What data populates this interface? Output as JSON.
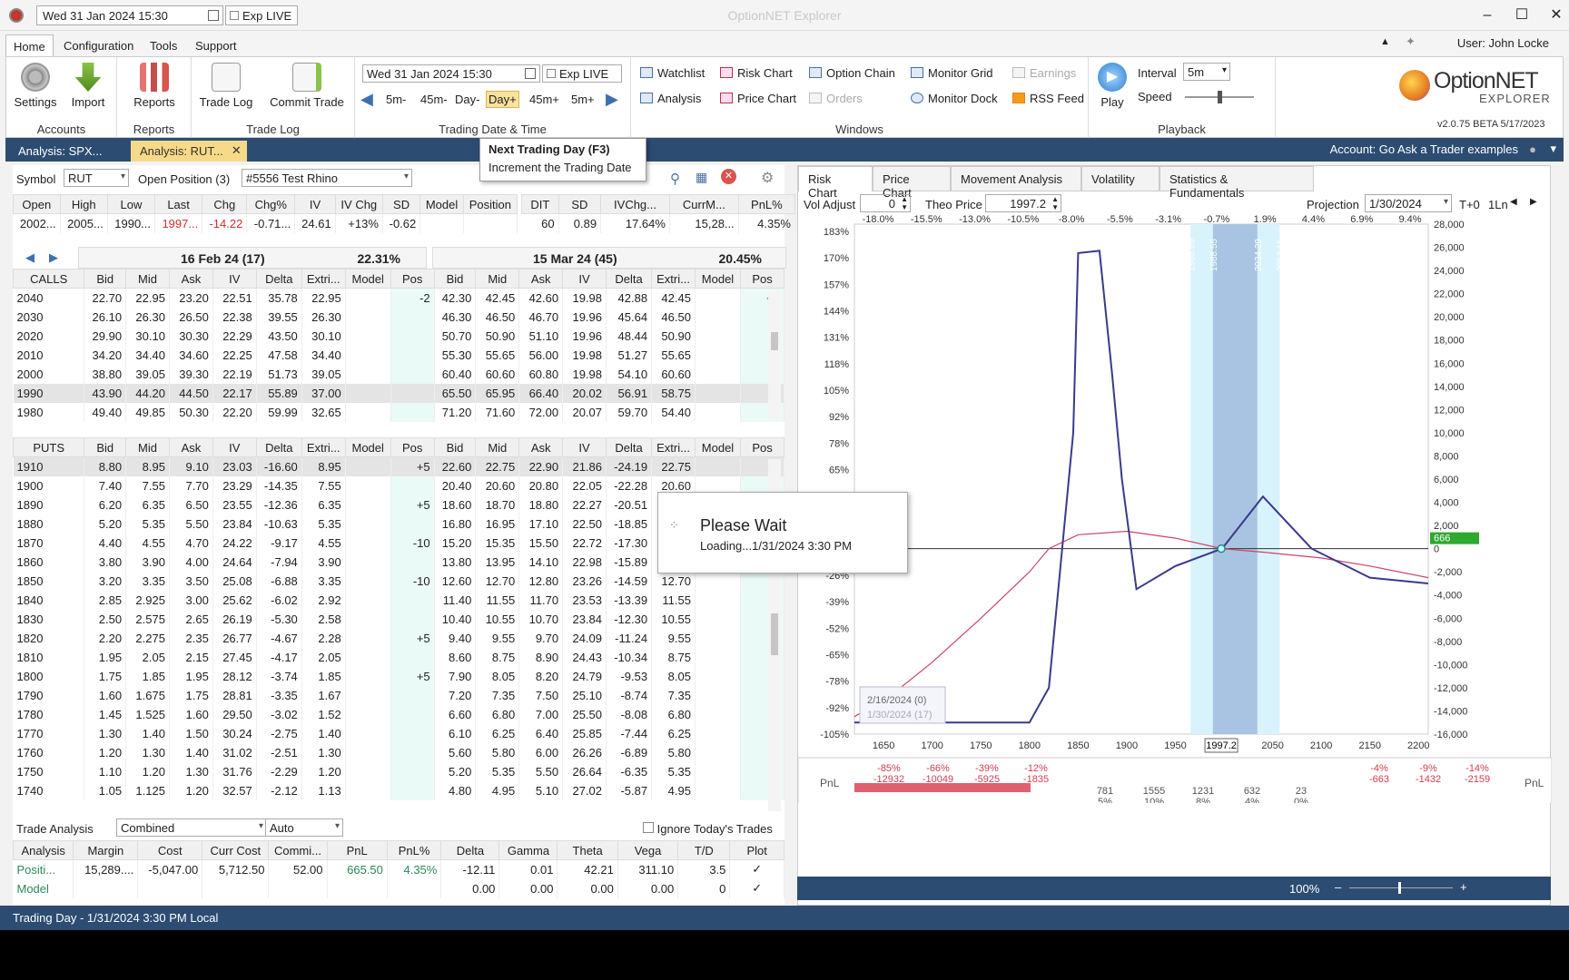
{
  "window": {
    "title": "OptionNET Explorer",
    "date": "Wed 31 Jan 2024 15:30",
    "exp": "Exp LIVE"
  },
  "menu": {
    "tabs": [
      "Home",
      "Configuration",
      "Tools",
      "Support"
    ],
    "user": "User: John Locke"
  },
  "ribbon": {
    "settings": "Settings",
    "import": "Import",
    "accounts": "Accounts",
    "reports": "Reports",
    "reports_group": "Reports",
    "trade_log": "Trade Log",
    "commit_trade": "Commit Trade",
    "trade_log_group": "Trade Log",
    "date": "Wed 31 Jan 2024 15:30",
    "exp": "Exp LIVE",
    "steps": [
      "5m-",
      "45m-",
      "Day-",
      "Day+",
      "45m+",
      "5m+"
    ],
    "trading_group": "Trading Date & Time",
    "windows": {
      "watchlist": "Watchlist",
      "risk_chart": "Risk Chart",
      "option_chain": "Option Chain",
      "monitor_grid": "Monitor Grid",
      "earnings": "Earnings",
      "analysis": "Analysis",
      "price_chart": "Price Chart",
      "orders": "Orders",
      "monitor_dock": "Monitor Dock",
      "rss_feed": "RSS Feed",
      "group": "Windows"
    },
    "playback": {
      "play": "Play",
      "interval_label": "Interval",
      "interval": "5m",
      "speed_label": "Speed",
      "group": "Playback"
    },
    "logo": {
      "name": "OptionNET",
      "sub": "EXPLORER",
      "version": "v2.0.75 BETA 5/17/2023"
    }
  },
  "tooltip": {
    "title": "Next Trading Day (F3)",
    "text": "Increment the Trading Date"
  },
  "doctabs": {
    "tab1": "Analysis: SPX...",
    "tab2": "Analysis: RUT...",
    "account": "Account: Go Ask a Trader examples"
  },
  "left": {
    "symbol_label": "Symbol",
    "symbol": "RUT",
    "open_pos_label": "Open Position (3)",
    "position": "#5556 Test  Rhino",
    "quote_headers": [
      "Open",
      "High",
      "Low",
      "Last",
      "Chg",
      "Chg%",
      "IV",
      "IV Chg",
      "SD",
      "Model",
      "Position"
    ],
    "quote_values": [
      "2002...",
      "2005...",
      "1990...",
      "1997...",
      "-14.22",
      "-0.71...",
      "24.61",
      "+13%",
      "-0.62",
      "",
      ""
    ],
    "pos_headers": [
      "DIT",
      "SD",
      "IVChg...",
      "CurrM...",
      "PnL%"
    ],
    "pos_values": [
      "60",
      "0.89",
      "17.64%",
      "15,28...",
      "4.35%"
    ],
    "exp1": {
      "label": "16 Feb 24 (17)",
      "iv": "22.31%"
    },
    "exp2": {
      "label": "15 Mar 24 (45)",
      "iv": "20.45%"
    },
    "calls_label": "CALLS",
    "puts_label": "PUTS",
    "chain_headers": [
      "Bid",
      "Mid",
      "Ask",
      "IV",
      "Delta",
      "Extri...",
      "Model",
      "Pos"
    ],
    "calls": [
      [
        "2040",
        "22.70",
        "22.95",
        "23.20",
        "22.51",
        "35.78",
        "22.95",
        "",
        "-2",
        "42.30",
        "42.45",
        "42.60",
        "19.98",
        "42.88",
        "42.45",
        "",
        "+2"
      ],
      [
        "2030",
        "26.10",
        "26.30",
        "26.50",
        "22.38",
        "39.55",
        "26.30",
        "",
        "",
        "46.30",
        "46.50",
        "46.70",
        "19.96",
        "45.64",
        "46.50",
        "",
        ""
      ],
      [
        "2020",
        "29.90",
        "30.10",
        "30.30",
        "22.29",
        "43.50",
        "30.10",
        "",
        "",
        "50.70",
        "50.90",
        "51.10",
        "19.96",
        "48.44",
        "50.90",
        "",
        ""
      ],
      [
        "2010",
        "34.20",
        "34.40",
        "34.60",
        "22.25",
        "47.58",
        "34.40",
        "",
        "",
        "55.30",
        "55.65",
        "56.00",
        "19.98",
        "51.27",
        "55.65",
        "",
        ""
      ],
      [
        "2000",
        "38.80",
        "39.05",
        "39.30",
        "22.19",
        "51.73",
        "39.05",
        "",
        "",
        "60.40",
        "60.60",
        "60.80",
        "19.98",
        "54.10",
        "60.60",
        "",
        ""
      ],
      [
        "1990",
        "43.90",
        "44.20",
        "44.50",
        "22.17",
        "55.89",
        "37.00",
        "",
        "",
        "65.50",
        "65.95",
        "66.40",
        "20.02",
        "56.91",
        "58.75",
        "",
        ""
      ],
      [
        "1980",
        "49.40",
        "49.85",
        "50.30",
        "22.20",
        "59.99",
        "32.65",
        "",
        "",
        "71.20",
        "71.60",
        "72.00",
        "20.07",
        "59.70",
        "54.40",
        "",
        ""
      ]
    ],
    "puts": [
      [
        "1910",
        "8.80",
        "8.95",
        "9.10",
        "23.03",
        "-16.60",
        "8.95",
        "",
        "+5",
        "22.60",
        "22.75",
        "22.90",
        "21.86",
        "-24.19",
        "22.75",
        "",
        ""
      ],
      [
        "1900",
        "7.40",
        "7.55",
        "7.70",
        "23.29",
        "-14.35",
        "7.55",
        "",
        "",
        "20.40",
        "20.60",
        "20.80",
        "22.05",
        "-22.28",
        "20.60",
        "",
        ""
      ],
      [
        "1890",
        "6.20",
        "6.35",
        "6.50",
        "23.55",
        "-12.36",
        "6.35",
        "",
        "+5",
        "18.60",
        "18.70",
        "18.80",
        "22.27",
        "-20.51",
        "18",
        "",
        ""
      ],
      [
        "1880",
        "5.20",
        "5.35",
        "5.50",
        "23.84",
        "-10.63",
        "5.35",
        "",
        "",
        "16.80",
        "16.95",
        "17.10",
        "22.50",
        "-18.85",
        "16",
        "",
        ""
      ],
      [
        "1870",
        "4.40",
        "4.55",
        "4.70",
        "24.22",
        "-9.17",
        "4.55",
        "",
        "-10",
        "15.20",
        "15.35",
        "15.50",
        "22.72",
        "-17.30",
        "15",
        "",
        ""
      ],
      [
        "1860",
        "3.80",
        "3.90",
        "4.00",
        "24.64",
        "-7.94",
        "3.90",
        "",
        "",
        "13.80",
        "13.95",
        "14.10",
        "22.98",
        "-15.89",
        "13",
        "",
        ""
      ],
      [
        "1850",
        "3.20",
        "3.35",
        "3.50",
        "25.08",
        "-6.88",
        "3.35",
        "",
        "-10",
        "12.60",
        "12.70",
        "12.80",
        "23.26",
        "-14.59",
        "12.70",
        "",
        ""
      ],
      [
        "1840",
        "2.85",
        "2.925",
        "3.00",
        "25.62",
        "-6.02",
        "2.92",
        "",
        "",
        "11.40",
        "11.55",
        "11.70",
        "23.53",
        "-13.39",
        "11.55",
        "",
        ""
      ],
      [
        "1830",
        "2.50",
        "2.575",
        "2.65",
        "26.19",
        "-5.30",
        "2.58",
        "",
        "",
        "10.40",
        "10.55",
        "10.70",
        "23.84",
        "-12.30",
        "10.55",
        "",
        ""
      ],
      [
        "1820",
        "2.20",
        "2.275",
        "2.35",
        "26.77",
        "-4.67",
        "2.28",
        "",
        "+5",
        "9.40",
        "9.55",
        "9.70",
        "24.09",
        "-11.24",
        "9.55",
        "",
        ""
      ],
      [
        "1810",
        "1.95",
        "2.05",
        "2.15",
        "27.45",
        "-4.17",
        "2.05",
        "",
        "",
        "8.60",
        "8.75",
        "8.90",
        "24.43",
        "-10.34",
        "8.75",
        "",
        ""
      ],
      [
        "1800",
        "1.75",
        "1.85",
        "1.95",
        "28.12",
        "-3.74",
        "1.85",
        "",
        "+5",
        "7.90",
        "8.05",
        "8.20",
        "24.79",
        "-9.53",
        "8.05",
        "",
        ""
      ],
      [
        "1790",
        "1.60",
        "1.675",
        "1.75",
        "28.81",
        "-3.35",
        "1.67",
        "",
        "",
        "7.20",
        "7.35",
        "7.50",
        "25.10",
        "-8.74",
        "7.35",
        "",
        ""
      ],
      [
        "1780",
        "1.45",
        "1.525",
        "1.60",
        "29.50",
        "-3.02",
        "1.52",
        "",
        "",
        "6.60",
        "6.80",
        "7.00",
        "25.50",
        "-8.08",
        "6.80",
        "",
        ""
      ],
      [
        "1770",
        "1.30",
        "1.40",
        "1.50",
        "30.24",
        "-2.75",
        "1.40",
        "",
        "",
        "6.10",
        "6.25",
        "6.40",
        "25.85",
        "-7.44",
        "6.25",
        "",
        ""
      ],
      [
        "1760",
        "1.20",
        "1.30",
        "1.40",
        "31.02",
        "-2.51",
        "1.30",
        "",
        "",
        "5.60",
        "5.80",
        "6.00",
        "26.26",
        "-6.89",
        "5.80",
        "",
        ""
      ],
      [
        "1750",
        "1.10",
        "1.20",
        "1.30",
        "31.76",
        "-2.29",
        "1.20",
        "",
        "",
        "5.20",
        "5.35",
        "5.50",
        "26.64",
        "-6.35",
        "5.35",
        "",
        ""
      ],
      [
        "1740",
        "1.05",
        "1.125",
        "1.20",
        "32.57",
        "-2.12",
        "1.13",
        "",
        "",
        "4.80",
        "4.95",
        "5.10",
        "27.02",
        "-5.87",
        "4.95",
        "",
        ""
      ]
    ],
    "trade_analysis_label": "Trade Analysis",
    "trade_analysis_mode": "Combined",
    "auto": "Auto",
    "ignore_label": "Ignore Today's Trades",
    "ta_headers": [
      "Analysis",
      "Margin",
      "Cost",
      "Curr Cost",
      "Commi...",
      "PnL",
      "PnL%",
      "Delta",
      "Gamma",
      "Theta",
      "Vega",
      "T/D",
      "Plot"
    ],
    "ta_rows": [
      [
        "Positi...",
        "15,289....",
        "-5,047.00",
        "5,712.50",
        "52.00",
        "665.50",
        "4.35%",
        "-12.11",
        "0.01",
        "42.21",
        "311.10",
        "3.5",
        "✓"
      ],
      [
        "Model",
        "",
        "",
        "",
        "",
        "",
        "",
        "0.00",
        "0.00",
        "0.00",
        "0.00",
        "0",
        "✓"
      ]
    ]
  },
  "wait": {
    "title": "Please Wait",
    "text": "Loading...1/31/2024 3:30 PM"
  },
  "right": {
    "tabs": [
      "Risk Chart",
      "Price Chart",
      "Movement Analysis",
      "Volatility",
      "Statistics & Fundamentals"
    ],
    "vol_adjust_label": "Vol Adjust",
    "vol_adjust": "0",
    "theo_label": "Theo Price",
    "theo": "1997.2",
    "projection_label": "Projection",
    "projection": "1/30/2024",
    "t0": "T+0",
    "iln": "1Ln",
    "top_pct": [
      "-18.0%",
      "-15.5%",
      "-13.0%",
      "-10.5%",
      "-8.0%",
      "-5.5%",
      "-3.1%",
      "-0.7%",
      "1.9%",
      "4.4%",
      "6.9%",
      "9.4%"
    ],
    "sd_labels": [
      "1965.69",
      "1988.55",
      "2034.29",
      "2057.15"
    ],
    "left_axis": [
      "183%",
      "170%",
      "157%",
      "144%",
      "131%",
      "118%",
      "105%",
      "92%",
      "78%",
      "65%",
      "52%",
      "0%",
      "-13%",
      "-26%",
      "-39%",
      "-52%",
      "-65%",
      "-78%",
      "-92%",
      "-105%"
    ],
    "left_badge": "4%",
    "right_badge": "666",
    "right_axis": [
      "28,000",
      "26,000",
      "24,000",
      "22,000",
      "20,000",
      "18,000",
      "16,000",
      "14,000",
      "12,000",
      "10,000",
      "8,000",
      "6,000",
      "4,000",
      "2,000",
      "0",
      "-2,000",
      "-4,000",
      "-6,000",
      "-8,000",
      "-10,000",
      "-12,000",
      "-14,000",
      "-16,000"
    ],
    "x_axis": [
      "1650",
      "1700",
      "1750",
      "1800",
      "1850",
      "1900",
      "1950",
      "2050",
      "2100",
      "2150",
      "2200"
    ],
    "x_marker": "1997.2",
    "legend": [
      "2/16/2024 (0)",
      "1/30/2024 (17)"
    ],
    "pnl_label": "PnL",
    "pnl_neg": [
      [
        "-85%",
        "-12932"
      ],
      [
        "-66%",
        "-10049"
      ],
      [
        "-39%",
        "-5925"
      ],
      [
        "-12%",
        "-1835"
      ]
    ],
    "pnl_pos": [
      [
        "781",
        "5%"
      ],
      [
        "1555",
        "10%"
      ],
      [
        "1231",
        "8%"
      ],
      [
        "632",
        "4%"
      ],
      [
        "23",
        "0%"
      ]
    ],
    "pnl_neg2": [
      [
        "-4%",
        "-663"
      ],
      [
        "-9%",
        "-1432"
      ],
      [
        "-14%",
        "-2159"
      ]
    ],
    "zoom": "100%"
  },
  "status": "Trading Day - 1/31/2024 3:30 PM Local",
  "chart_data": {
    "type": "line",
    "xlabel": "",
    "ylabel": "",
    "xlim": [
      1620,
      2210
    ],
    "ylim": [
      -16000,
      28000
    ],
    "series": [
      {
        "name": "2/16/2024 (0)",
        "color": "#3a3a8c",
        "x": [
          1620,
          1800,
          1820,
          1845,
          1850,
          1872,
          1885,
          1895,
          1910,
          1950,
          1998,
          2040,
          2090,
          2150,
          2210
        ],
        "y": [
          -15000,
          -15000,
          -12000,
          10000,
          25500,
          25700,
          15000,
          6000,
          -3500,
          -1500,
          0,
          4500,
          0,
          -2500,
          -3000
        ]
      },
      {
        "name": "1/30/2024 (17)",
        "color": "#cc4466",
        "x": [
          1620,
          1660,
          1700,
          1750,
          1800,
          1820,
          1850,
          1900,
          1950,
          1998,
          2040,
          2100,
          2150,
          2210
        ],
        "y": [
          -14500,
          -12500,
          -9800,
          -6000,
          -2000,
          0,
          1200,
          1500,
          900,
          0,
          -300,
          -800,
          -1500,
          -2500
        ]
      }
    ],
    "current_price": 1997.2
  }
}
